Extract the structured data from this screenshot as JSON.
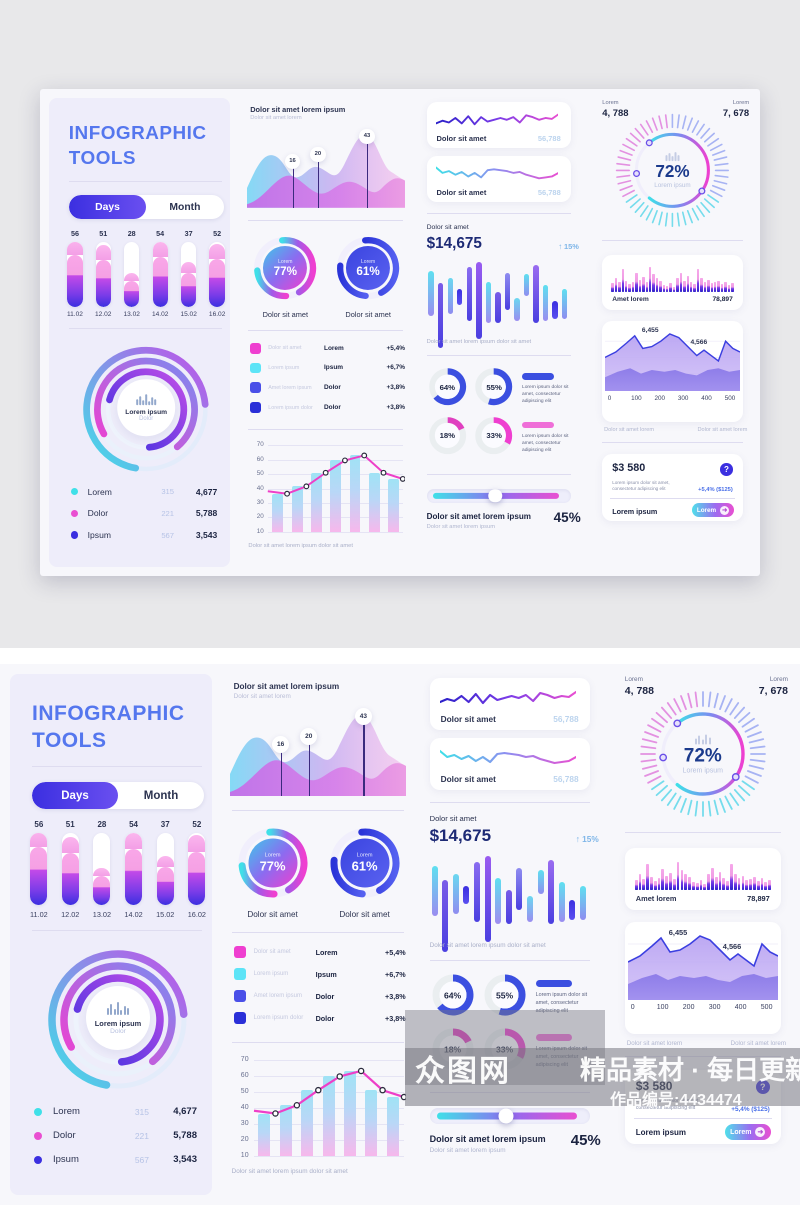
{
  "meta": {
    "watermark_logo": "众图网",
    "watermark_tagline": "精品素材 · 每日更新",
    "watermark_code": "作品编号:4434474"
  },
  "colors": {
    "accent_blue": "#3b2fe0",
    "accent_pink": "#e94fd1",
    "accent_cyan": "#3fe0e8",
    "accent_violet": "#7a3ce8",
    "title_blue": "#5577ee",
    "panel_bg": "#f7f7fb",
    "card_bg": "#ffffff"
  },
  "col1": {
    "title_line1": "INFOGRAPHIC",
    "title_line2": "TOOLS",
    "toggle": {
      "days_label": "Days",
      "month_label": "Month",
      "active": "Days"
    },
    "bars_chart": {
      "type": "bar",
      "categories": [
        "11.02",
        "12.02",
        "13.02",
        "14.02",
        "15.02",
        "16.02"
      ],
      "values": [
        56,
        51,
        28,
        54,
        37,
        52
      ],
      "ylim": [
        0,
        70
      ],
      "title": "",
      "xlabel": "",
      "ylabel": ""
    },
    "donut": {
      "center_title": "Lorem ipsum",
      "center_sub": "Dolor",
      "icon": "bar-chart-icon"
    },
    "legend": {
      "headers_visible": false,
      "rows": [
        {
          "color": "#3fe0e8",
          "name": "Lorem",
          "mid": "315",
          "value": "4,677"
        },
        {
          "color": "#e94fd1",
          "name": "Dolor",
          "mid": "221",
          "value": "5,788"
        },
        {
          "color": "#3b2fe0",
          "name": "Ipsum",
          "mid": "567",
          "value": "3,543"
        }
      ]
    }
  },
  "col2": {
    "area": {
      "heading": "Dolor sit amet lorem ipsum",
      "sub": "Dolor sit amet lorem",
      "markers": [
        {
          "label": "16",
          "x_pct": 29
        },
        {
          "label": "20",
          "x_pct": 45
        },
        {
          "label": "43",
          "x_pct": 76
        }
      ]
    },
    "donuts": [
      {
        "inner_label": "Lorem",
        "value": "77%",
        "caption": "Dolor sit amet",
        "style": "pink"
      },
      {
        "inner_label": "Lorem",
        "value": "61%",
        "caption": "Dolor sit amet",
        "style": "blue"
      }
    ],
    "legend_rows": [
      {
        "swatch": "#ef3fd0",
        "label": "Dolor sit amet",
        "mid": "Lorem",
        "delta": "+5,4%"
      },
      {
        "swatch": "#5de4f7",
        "label": "Lorem ipsum",
        "mid": "Ipsum",
        "delta": "+6,7%"
      },
      {
        "swatch": "#4a4fe8",
        "label": "Amet lorem ipsum",
        "mid": "Dolor",
        "delta": "+3,8%"
      },
      {
        "swatch": "#2a2fd8",
        "label": "Lorem ipsum dolor",
        "mid": "Dolor",
        "delta": "+3,8%"
      }
    ],
    "combo_chart": {
      "type": "bar",
      "y_ticks": [
        70,
        60,
        50,
        40,
        30,
        20,
        10
      ],
      "ylim": [
        10,
        70
      ],
      "bars": [
        36,
        42,
        53,
        63,
        67,
        53,
        48
      ],
      "line": [
        38,
        36,
        42,
        53,
        63,
        67,
        53,
        48
      ],
      "caption": "Dolor sit amet lorem ipsum dolor sit amet"
    }
  },
  "col3": {
    "mini_cards": [
      {
        "label": "Dolor sit amet",
        "value": "56,788",
        "line_style": "dark-blue-pink"
      },
      {
        "label": "Dolor sit amet",
        "value": "56,788",
        "line_style": "cyan-pink"
      }
    ],
    "stat": {
      "kicker": "Dolor sit amet",
      "amount": "$14,675",
      "delta": "15%",
      "delta_arrow": "↑",
      "caption": "Dolor sit amet lorem ipsum dolor sit amet"
    },
    "rings": [
      {
        "value": "64%",
        "color": "#3b4fe0"
      },
      {
        "value": "55%",
        "color": "#3b4fe0"
      },
      {
        "value": "18%",
        "color": "#e03fc0"
      },
      {
        "value": "33%",
        "color": "#ef3fd0"
      }
    ],
    "ring_notes": [
      {
        "pill_color": "#3b4fe0",
        "text": "Lorem ipsum dolor sit amet, consectetur adipiscing elit"
      },
      {
        "pill_color": "#ef6fd8",
        "text": "Lorem ipsum dolor sit amet, consectetur adipiscing elit"
      }
    ],
    "slider": {
      "percent": 45,
      "title": "Dolor sit amet lorem ipsum",
      "sub": "Dolor sit amet lorem ipsum",
      "value_label": "45%"
    }
  },
  "col4": {
    "kpis": [
      {
        "label": "Lorem",
        "value": "4, 788",
        "align": "left"
      },
      {
        "label": "Lorem",
        "value": "7, 678",
        "align": "right"
      }
    ],
    "gauge": {
      "value": "72%",
      "caption": "Lorem ipsum",
      "icon": "bar-chart-icon",
      "ticks": 52
    },
    "histogram": {
      "label": "Amet lorem",
      "value": "78,897"
    },
    "area_chart": {
      "type": "area",
      "annotations": [
        "6,455",
        "4,566"
      ],
      "x_ticks": [
        "0",
        "100",
        "200",
        "300",
        "400",
        "500"
      ],
      "caption_left": "Dolor sit amet lorem",
      "caption_right": "Dolor sit amet lorem"
    },
    "promo": {
      "amount": "$3 580",
      "help_icon": "question-icon",
      "desc": "Lorem ipsum dolor sit amet, consectetur adipiscing elit",
      "delta": "+5,4%  ($125)",
      "foot_label": "Lorem ipsum",
      "button_label": "Lorem",
      "button_icon": "arrow-right-icon"
    }
  }
}
